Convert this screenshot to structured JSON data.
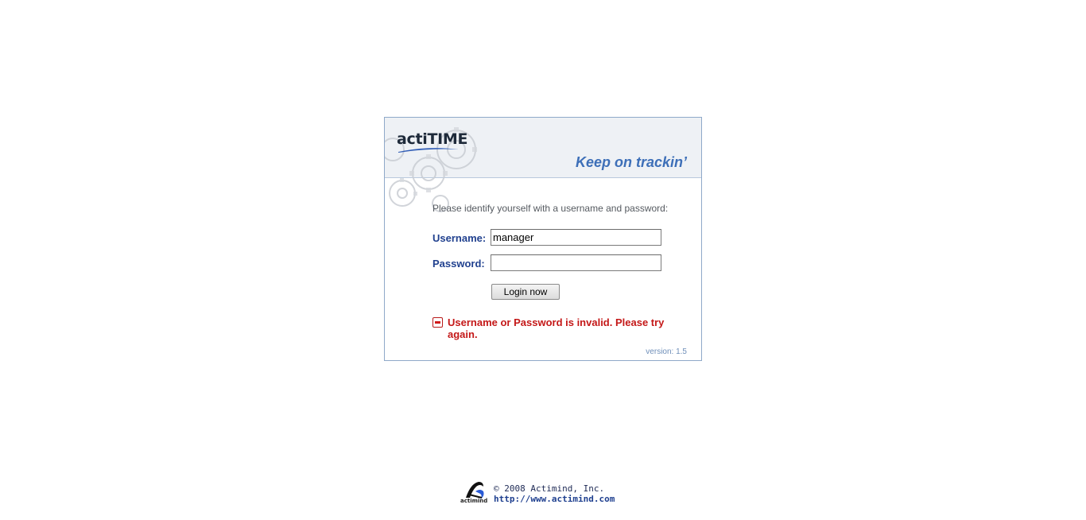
{
  "app": {
    "logo_text": "actiTIME",
    "tagline": "Keep on trackin’",
    "version": "version: 1.5"
  },
  "login_form": {
    "instructions": "Please identify yourself with a username and password:",
    "username_label": "Username:",
    "username_value": "manager",
    "password_label": "Password:",
    "password_value": "",
    "login_button_label": "Login now",
    "error_message": "Username or Password is invalid. Please try again."
  },
  "footer": {
    "company_logo_text": "actimind",
    "copyright": "© 2008 Actimind, Inc.",
    "website": "http://www.actimind.com"
  },
  "colors": {
    "panel_border": "#8fa9c9",
    "label_blue": "#21418f",
    "tagline_blue": "#3d6fb8",
    "error_red": "#c41818"
  },
  "icons": [
    "gears-decoration-icon",
    "actitime-logo-swoosh-icon",
    "error-minus-icon",
    "actimind-logo-icon"
  ]
}
